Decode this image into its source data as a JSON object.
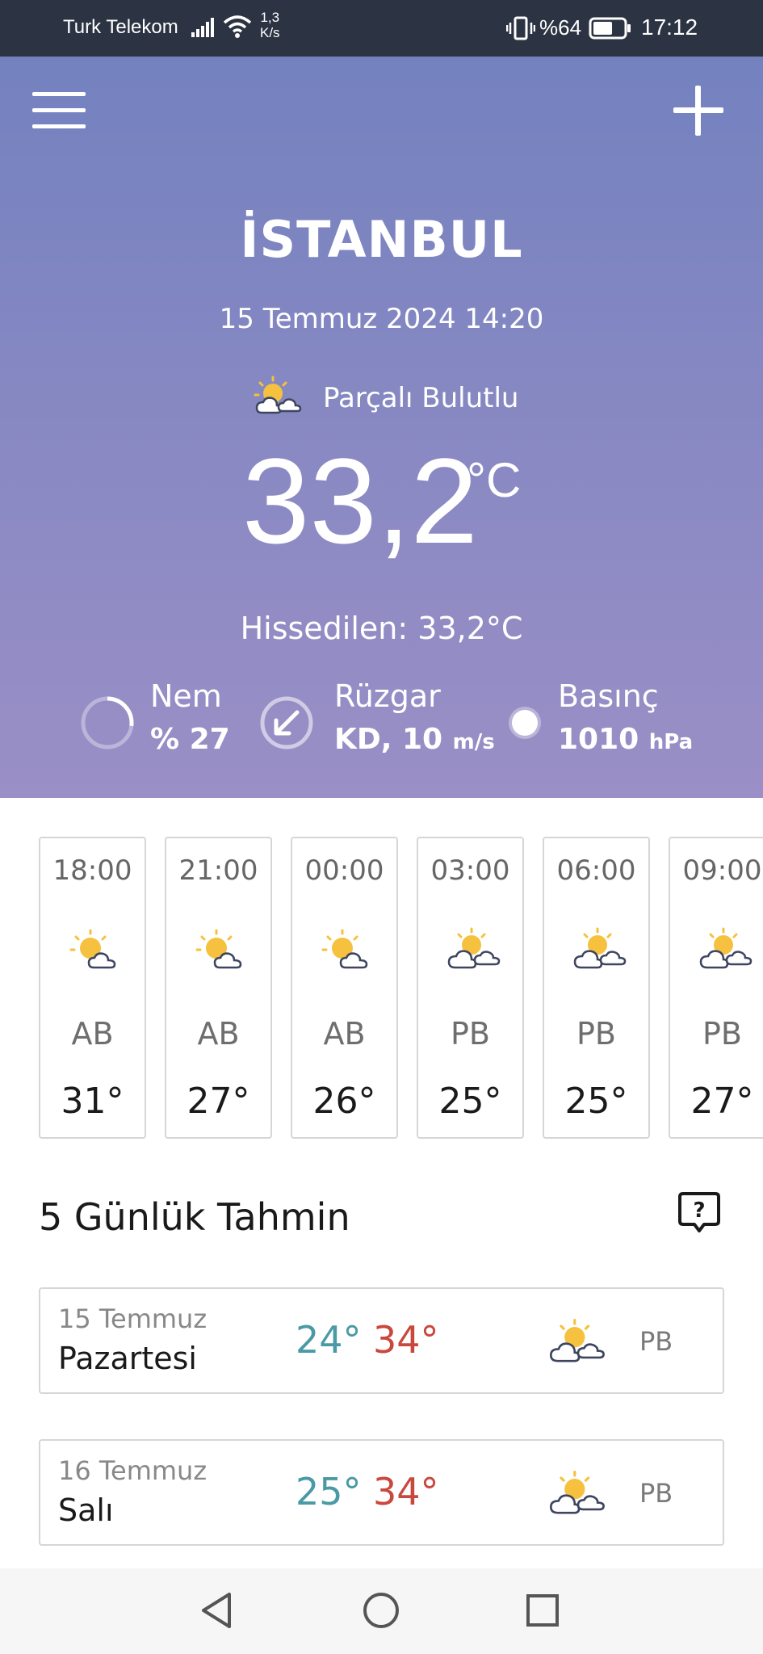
{
  "status_bar": {
    "carrier": "Turk Telekom",
    "net_speed_value": "1,3",
    "net_speed_unit": "K/s",
    "battery_pct": "%64",
    "battery_level": 0.64,
    "time": "17:12"
  },
  "current": {
    "city": "İSTANBUL",
    "datetime": "15 Temmuz 2024 14:20",
    "condition": "Parçalı Bulutlu",
    "condition_icon": "partly-cloudy-icon",
    "temperature": "33,2",
    "temperature_unit": "°C",
    "feels_like": "Hissedilen: 33,2°C",
    "humidity": {
      "label": "Nem",
      "value": "% 27",
      "ring_fraction": 0.27
    },
    "wind": {
      "label": "Rüzgar",
      "value": "KD, 10",
      "unit": "m/s",
      "direction": "KD"
    },
    "pressure": {
      "label": "Basınç",
      "value": "1010",
      "unit": "hPa"
    }
  },
  "hourly": [
    {
      "time": "18:00",
      "condition": "AB",
      "temp": "31°",
      "icon": "sun-cloud-icon"
    },
    {
      "time": "21:00",
      "condition": "AB",
      "temp": "27°",
      "icon": "sun-cloud-icon"
    },
    {
      "time": "00:00",
      "condition": "AB",
      "temp": "26°",
      "icon": "sun-cloud-icon"
    },
    {
      "time": "03:00",
      "condition": "PB",
      "temp": "25°",
      "icon": "partly-cloudy-icon"
    },
    {
      "time": "06:00",
      "condition": "PB",
      "temp": "25°",
      "icon": "partly-cloudy-icon"
    },
    {
      "time": "09:00",
      "condition": "PB",
      "temp": "27°",
      "icon": "partly-cloudy-icon"
    }
  ],
  "forecast": {
    "title": "5 Günlük Tahmin",
    "days": [
      {
        "date": "15 Temmuz",
        "day": "Pazartesi",
        "low": "24°",
        "high": "34°",
        "condition": "PB",
        "icon": "partly-cloudy-icon"
      },
      {
        "date": "16 Temmuz",
        "day": "Salı",
        "low": "25°",
        "high": "34°",
        "condition": "PB",
        "icon": "partly-cloudy-icon"
      }
    ]
  },
  "colors": {
    "status_bar_bg": "#2c3343",
    "hero_top": "#7382bf",
    "hero_bottom": "#9a8fc6",
    "low_temp": "#4a9aa6",
    "high_temp": "#c9483e",
    "sun": "#f5c13e"
  }
}
